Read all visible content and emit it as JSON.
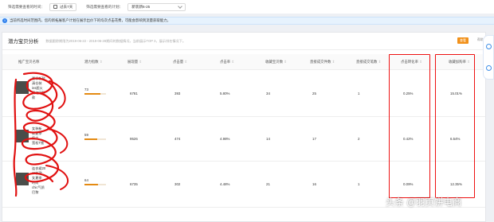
{
  "filters": {
    "date_label": "筛选需要查看的时间：",
    "date_value": "过去7天",
    "plan_label": "筛选需要查看的计划：",
    "plan_value": "新装新6-25"
  },
  "notice": {
    "icon": "info-icon",
    "text": "当前所选时间范围内，您的新拓展客户计划在展示出价下的均次点击花费，可能会影响到流量获取能力。"
  },
  "card": {
    "title": "潜力宝贝分析",
    "note": "数据跟踪期限为2019-06-22 - 2019-06-28期间的数据情况，当前展示TOP 3，展示排名情况下。",
    "button": "查看",
    "side_link": "帮助"
  },
  "table": {
    "headers": [
      {
        "label": "推广宝贝名称",
        "sort": ""
      },
      {
        "label": "潜力指数",
        "sort": "⇕"
      },
      {
        "label": "展现量",
        "sort": "⇕"
      },
      {
        "label": "点击量",
        "sort": "⇕"
      },
      {
        "label": "点击率",
        "sort": "⇕"
      },
      {
        "label": "收藏宝贝数",
        "sort": "⇕"
      },
      {
        "label": "直接成交件数",
        "sort": "⇕"
      },
      {
        "label": "直接成交笔数",
        "sort": "⇕"
      },
      {
        "label": "点击转化率",
        "sort": "⇕"
      },
      {
        "label": "收藏加购率",
        "sort": "⇕"
      }
    ],
    "rows": [
      {
        "product": [
          "夏季新款",
          "清仓装",
          "ins超火",
          "网红同款",
          "款"
        ],
        "potential": "73",
        "potential_pct": 73,
        "impressions": "6781",
        "clicks": "393",
        "ctr": "5.80%",
        "favorites": "34",
        "direct_items": "25",
        "direct_orders": "1",
        "cvr": "0.25%",
        "fav_cart_rate": "15.01%"
      },
      {
        "product": [
          "女装新",
          "款夏季",
          "复古",
          "宽松T恤"
        ],
        "potential": "59",
        "potential_pct": 59,
        "impressions": "9526",
        "clicks": "474",
        "ctr": "4.98%",
        "favorites": "14",
        "direct_items": "17",
        "direct_orders": "2",
        "cvr": "0.42%",
        "fav_cart_rate": "6.54%"
      },
      {
        "product": [
          "连衣裙20",
          "19新款",
          "女夏季",
          "时尚",
          "chic气质",
          "巴黎"
        ],
        "potential": "64",
        "potential_pct": 64,
        "impressions": "6735",
        "clicks": "302",
        "ctr": "4.48%",
        "favorites": "21",
        "direct_items": "16",
        "direct_orders": "1",
        "cvr": "0.09%",
        "fav_cart_rate": "12.35%"
      }
    ]
  },
  "watermark": "头条 @羽页饼电商",
  "colors": {
    "accent": "#f2911a",
    "info": "#2f80ed",
    "annotation": "#e11111",
    "bar": "#e48a12"
  }
}
